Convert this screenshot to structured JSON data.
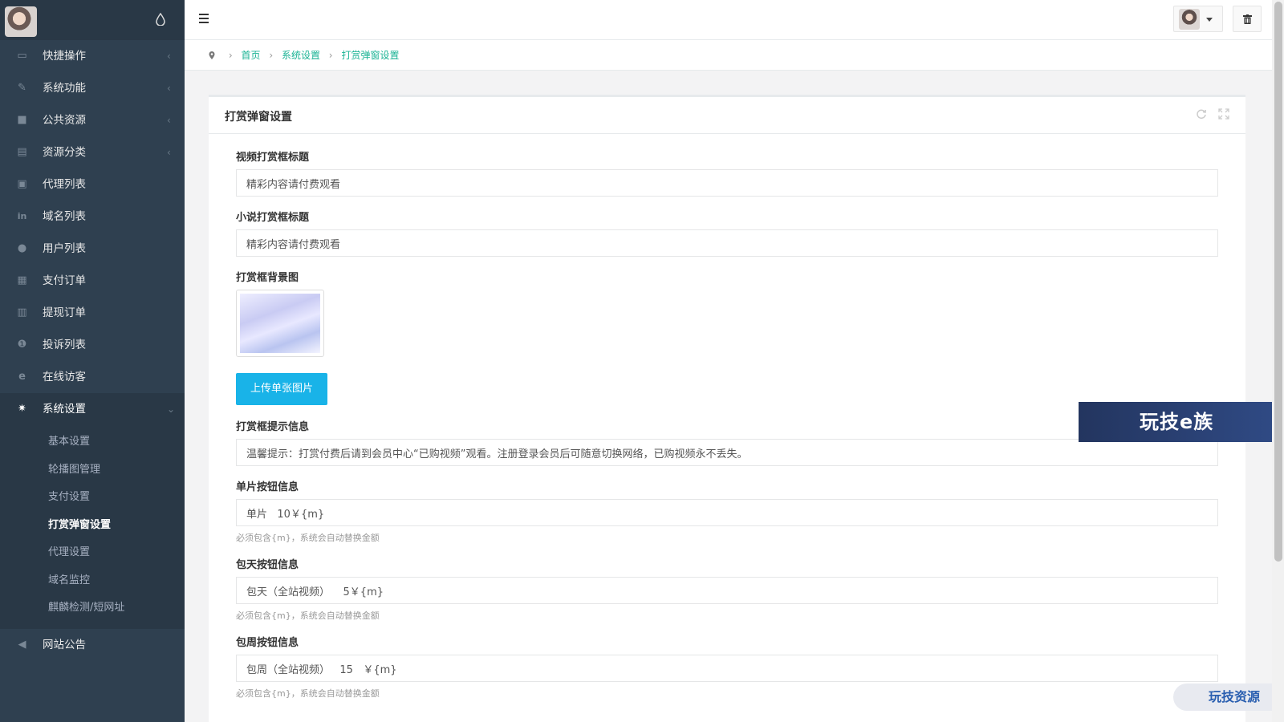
{
  "sidebar": {
    "items": [
      {
        "label": "快捷操作",
        "icon": "folder-icon",
        "chev": "‹"
      },
      {
        "label": "系统功能",
        "icon": "wrench-icon",
        "chev": "‹"
      },
      {
        "label": "公共资源",
        "icon": "video-icon",
        "chev": "‹"
      },
      {
        "label": "资源分类",
        "icon": "list-icon",
        "chev": "‹"
      },
      {
        "label": "代理列表",
        "icon": "gift-icon",
        "chev": ""
      },
      {
        "label": "域名列表",
        "icon": "linkedin-icon",
        "chev": ""
      },
      {
        "label": "用户列表",
        "icon": "user-icon",
        "chev": ""
      },
      {
        "label": "支付订单",
        "icon": "doc-icon",
        "chev": ""
      },
      {
        "label": "提现订单",
        "icon": "bank-icon",
        "chev": ""
      },
      {
        "label": "投诉列表",
        "icon": "alert-icon",
        "chev": ""
      },
      {
        "label": "在线访客",
        "icon": "ie-icon",
        "chev": ""
      },
      {
        "label": "系统设置",
        "icon": "gear-icon",
        "chev": "⌄"
      }
    ],
    "submenu": [
      "基本设置",
      "轮播图管理",
      "支付设置",
      "打赏弹窗设置",
      "代理设置",
      "域名监控",
      "麒麟检测/短网址"
    ],
    "last_item": {
      "label": "网站公告",
      "icon": "megaphone-icon"
    }
  },
  "breadcrumb": {
    "home": "首页",
    "section": "系统设置",
    "current": "打赏弹窗设置"
  },
  "card": {
    "title": "打赏弹窗设置"
  },
  "form": {
    "video_title_label": "视频打赏框标题",
    "video_title_value": "精彩内容请付费观看",
    "novel_title_label": "小说打赏框标题",
    "novel_title_value": "精彩内容请付费观看",
    "bg_label": "打赏框背景图",
    "upload_label": "上传单张图片",
    "tip_label": "打赏框提示信息",
    "tip_value": "温馨提示：打赏付费后请到会员中心“已购视频”观看。注册登录会员后可随意切换网络，已购视频永不丢失。",
    "single_label": "单片按钮信息",
    "single_value": "单片   10￥{m}",
    "day_label": "包天按钮信息",
    "day_value": "包天（全站视频）    5￥{m}",
    "week_label": "包周按钮信息",
    "week_value": "包周（全站视频）   15   ￥{m}",
    "hint": "必须包含{m}，系统会自动替换金额"
  },
  "watermarks": {
    "banner": "玩技e族",
    "pill": "玩技资源"
  }
}
